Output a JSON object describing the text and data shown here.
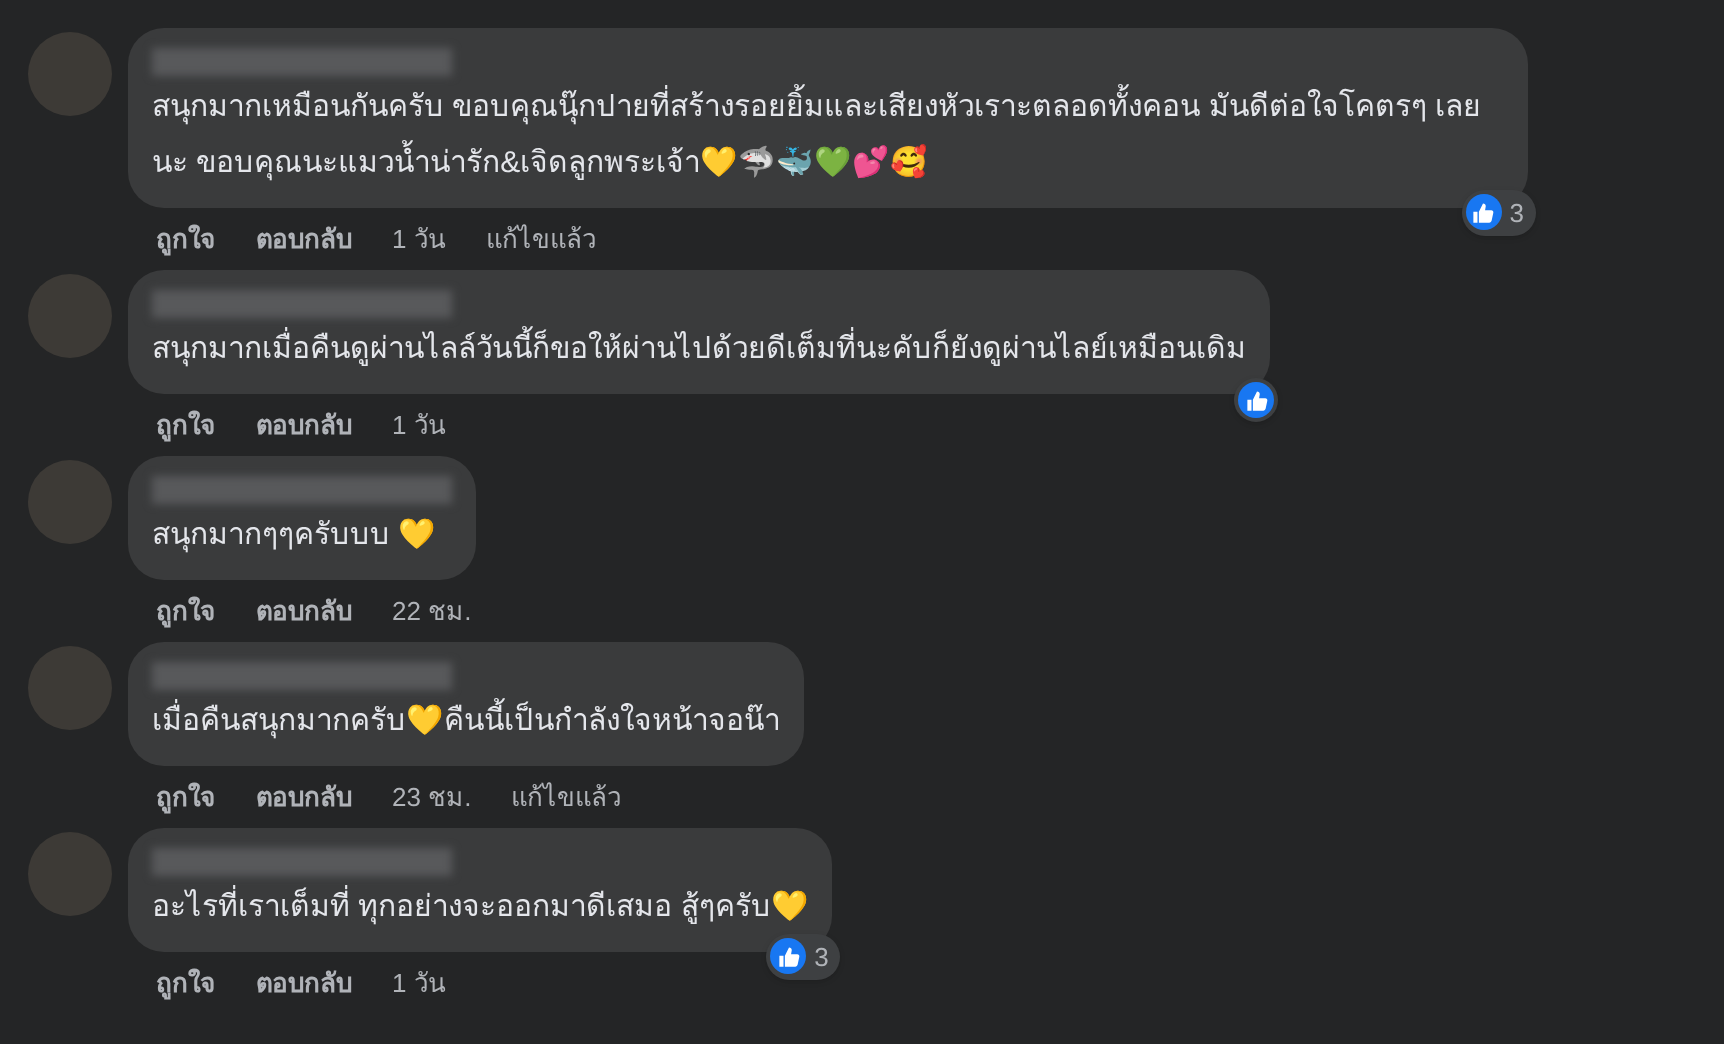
{
  "comments": [
    {
      "text": "สนุกมากเหมือนกันครับ ขอบคุณนุ๊กปายที่สร้างรอยยิ้มและเสียงหัวเราะตลอดทั้งคอน มันดีต่อใจโคตรๆ เลยนะ ขอบคุณนะแมวน้ำน่ารัก&เจิดลูกพระเจ้า💛🦈🐳💚💕🥰",
      "reaction": {
        "count": "3"
      },
      "actions": [
        "ถูกใจ",
        "ตอบกลับ"
      ],
      "time": "1 วัน",
      "edited": "แก้ไขแล้ว"
    },
    {
      "text": "สนุกมากเมื่อคืนดูผ่านไลล์วันนี้ก็ขอให้ผ่านไปด้วยดีเต็มที่นะคับก็ยังดูผ่านไลย์เหมือนเดิม",
      "reaction": {
        "shown": true
      },
      "actions": [
        "ถูกใจ",
        "ตอบกลับ"
      ],
      "time": "1 วัน"
    },
    {
      "text": "สนุกมากๆๆครับบบ 💛",
      "actions": [
        "ถูกใจ",
        "ตอบกลับ"
      ],
      "time": "22 ชม."
    },
    {
      "text": "เมื่อคืนสนุกมากครับ💛คืนนี้เป็นกำลังใจหน้าจอน๊า",
      "actions": [
        "ถูกใจ",
        "ตอบกลับ"
      ],
      "time": "23 ชม.",
      "edited": "แก้ไขแล้ว"
    },
    {
      "text": "อะไรที่เราเต็มที่ ทุกอย่างจะออกมาดีเสมอ สู้ๆครับ💛",
      "reaction": {
        "count": "3"
      },
      "actions": [
        "ถูกใจ",
        "ตอบกลับ"
      ],
      "time": "1 วัน"
    }
  ]
}
